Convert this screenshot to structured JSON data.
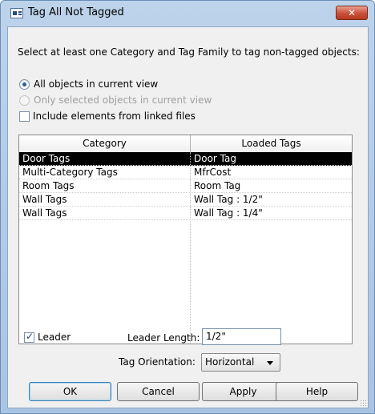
{
  "window": {
    "title": "Tag All Not Tagged",
    "close_label": "✕"
  },
  "instruction": "Select at least one Category and Tag Family to tag non-tagged objects:",
  "options": {
    "all_objects": "All objects in current view",
    "only_selected": "Only selected objects in current view",
    "include_linked": "Include elements from linked files"
  },
  "grid": {
    "headers": [
      "Category",
      "Loaded Tags"
    ],
    "rows": [
      {
        "category": "Door Tags",
        "tag": "Door Tag",
        "selected": true
      },
      {
        "category": "Multi-Category Tags",
        "tag": "MfrCost",
        "selected": false
      },
      {
        "category": "Room Tags",
        "tag": "Room Tag",
        "selected": false
      },
      {
        "category": "Wall Tags",
        "tag": "Wall Tag : 1/2\"",
        "selected": false
      },
      {
        "category": "Wall Tags",
        "tag": "Wall Tag : 1/4\"",
        "selected": false
      }
    ]
  },
  "leader": {
    "checkbox_label": "Leader",
    "checked": true,
    "length_label": "Leader Length:",
    "length_value": "1/2\""
  },
  "orientation": {
    "label": "Tag Orientation:",
    "value": "Horizontal"
  },
  "buttons": {
    "ok": "OK",
    "cancel": "Cancel",
    "apply": "Apply",
    "help": "Help"
  }
}
